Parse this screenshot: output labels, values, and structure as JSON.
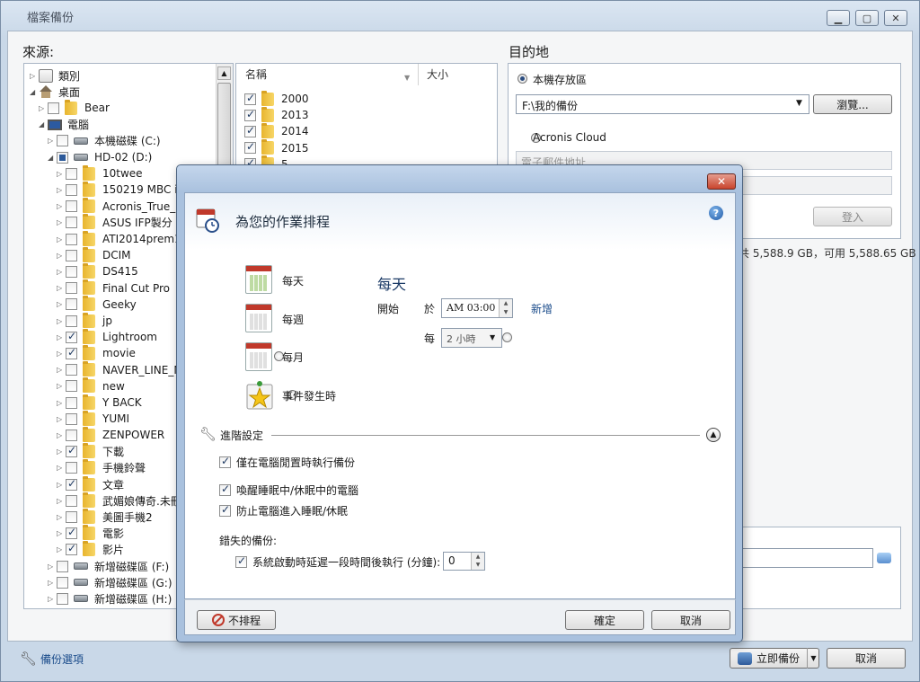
{
  "main_window": {
    "title": "檔案備份",
    "source_label": "來源:",
    "dest_label": "目的地",
    "file_list": {
      "col_name": "名稱",
      "col_size": "大小",
      "items": [
        {
          "label": "2000",
          "checked": true
        },
        {
          "label": "2013",
          "checked": true
        },
        {
          "label": "2014",
          "checked": true
        },
        {
          "label": "2015",
          "checked": true
        },
        {
          "label": "5",
          "checked": true
        }
      ]
    },
    "tree": [
      {
        "label": "類別",
        "type": "cat",
        "level": 0,
        "arrow": "▷",
        "cb": "none"
      },
      {
        "label": "桌面",
        "type": "home",
        "level": 0,
        "arrow": "◢",
        "cb": "none"
      },
      {
        "label": "Bear",
        "type": "folder",
        "level": 1,
        "arrow": "▷",
        "cb": "unchecked"
      },
      {
        "label": "電腦",
        "type": "pc",
        "level": 1,
        "arrow": "◢",
        "cb": "none"
      },
      {
        "label": "本機磁碟 (C:)",
        "type": "drive",
        "level": 2,
        "arrow": "▷",
        "cb": "unchecked"
      },
      {
        "label": "HD-02 (D:)",
        "type": "drive",
        "level": 2,
        "arrow": "◢",
        "cb": "partial"
      },
      {
        "label": "10twee",
        "type": "folder",
        "level": 3,
        "arrow": "▷",
        "cb": "unchecked"
      },
      {
        "label": "150219 MBC ide",
        "type": "folder",
        "level": 3,
        "arrow": "▷",
        "cb": "unchecked"
      },
      {
        "label": "Acronis_True_In",
        "type": "folder",
        "level": 3,
        "arrow": "▷",
        "cb": "unchecked"
      },
      {
        "label": "ASUS IFP製分",
        "type": "folder",
        "level": 3,
        "arrow": "▷",
        "cb": "unchecked"
      },
      {
        "label": "ATI2014prem17",
        "type": "folder",
        "level": 3,
        "arrow": "▷",
        "cb": "unchecked"
      },
      {
        "label": "DCIM",
        "type": "folder",
        "level": 3,
        "arrow": "▷",
        "cb": "unchecked"
      },
      {
        "label": "DS415",
        "type": "folder",
        "level": 3,
        "arrow": "▷",
        "cb": "unchecked"
      },
      {
        "label": "Final Cut Pro",
        "type": "folder",
        "level": 3,
        "arrow": "▷",
        "cb": "unchecked"
      },
      {
        "label": "Geeky",
        "type": "folder",
        "level": 3,
        "arrow": "▷",
        "cb": "unchecked"
      },
      {
        "label": "jp",
        "type": "folder",
        "level": 3,
        "arrow": "▷",
        "cb": "unchecked"
      },
      {
        "label": "Lightroom",
        "type": "folder",
        "level": 3,
        "arrow": "▷",
        "cb": "checked"
      },
      {
        "label": "movie",
        "type": "folder",
        "level": 3,
        "arrow": "▷",
        "cb": "checked"
      },
      {
        "label": "NAVER_LINE_M",
        "type": "folder",
        "level": 3,
        "arrow": "▷",
        "cb": "unchecked"
      },
      {
        "label": "new",
        "type": "folder",
        "level": 3,
        "arrow": "▷",
        "cb": "unchecked"
      },
      {
        "label": "Y BACK",
        "type": "folder",
        "level": 3,
        "arrow": "▷",
        "cb": "unchecked"
      },
      {
        "label": "YUMI",
        "type": "folder",
        "level": 3,
        "arrow": "▷",
        "cb": "unchecked"
      },
      {
        "label": "ZENPOWER",
        "type": "folder",
        "level": 3,
        "arrow": "▷",
        "cb": "unchecked"
      },
      {
        "label": "下載",
        "type": "folder",
        "level": 3,
        "arrow": "▷",
        "cb": "checked"
      },
      {
        "label": "手機鈴聲",
        "type": "folder",
        "level": 3,
        "arrow": "▷",
        "cb": "unchecked"
      },
      {
        "label": "文章",
        "type": "folder",
        "level": 3,
        "arrow": "▷",
        "cb": "checked"
      },
      {
        "label": "武媚娘傳奇.未刪",
        "type": "folder",
        "level": 3,
        "arrow": "▷",
        "cb": "unchecked"
      },
      {
        "label": "美圖手機2",
        "type": "folder",
        "level": 3,
        "arrow": "▷",
        "cb": "unchecked"
      },
      {
        "label": "電影",
        "type": "folder",
        "level": 3,
        "arrow": "▷",
        "cb": "checked"
      },
      {
        "label": "影片",
        "type": "folder",
        "level": 3,
        "arrow": "▷",
        "cb": "checked"
      },
      {
        "label": "新增磁碟區 (F:)",
        "type": "drive",
        "level": 2,
        "arrow": "▷",
        "cb": "unchecked"
      },
      {
        "label": "新增磁碟區 (G:)",
        "type": "drive",
        "level": 2,
        "arrow": "▷",
        "cb": "unchecked"
      },
      {
        "label": "新增磁碟區 (H:)",
        "type": "drive",
        "level": 2,
        "arrow": "▷",
        "cb": "unchecked"
      }
    ],
    "destination": {
      "local_label": "本機存放區",
      "path_value": "F:\\我的備份",
      "browse_label": "瀏覽...",
      "cloud_label": "Acronis Cloud",
      "email_placeholder": "電子郵件地址",
      "login_label": "登入",
      "space_info": "共 5,588.9 GB，可用 5,588.65 GB"
    },
    "footer": {
      "backup_options": "備份選項",
      "backup_now": "立即備份",
      "cancel": "取消"
    }
  },
  "dialog": {
    "title": "為您的作業排程",
    "options": [
      {
        "label": "每天",
        "selected": true
      },
      {
        "label": "每週",
        "selected": false
      },
      {
        "label": "每月",
        "selected": false
      },
      {
        "label": "事件發生時",
        "selected": false
      }
    ],
    "daily": {
      "heading": "每天",
      "start_label": "開始",
      "at_label": "於",
      "time_value": "AM 03:00",
      "add_link": "新增",
      "every_label": "每",
      "interval_value": "2 小時"
    },
    "advanced": {
      "label": "進階設定",
      "idle_only": {
        "label": "僅在電腦閒置時執行備份",
        "checked": true
      },
      "wake": {
        "label": "喚醒睡眠中/休眠中的電腦",
        "checked": true
      },
      "prevent_sleep": {
        "label": "防止電腦進入睡眠/休眠",
        "checked": true
      },
      "missed_label": "錯失的備份:",
      "delay": {
        "label": "系統啟動時延遲一段時間後執行 (分鐘):",
        "checked": true,
        "value": "0"
      }
    },
    "footer": {
      "no_schedule": "不排程",
      "ok": "確定",
      "cancel": "取消"
    }
  }
}
